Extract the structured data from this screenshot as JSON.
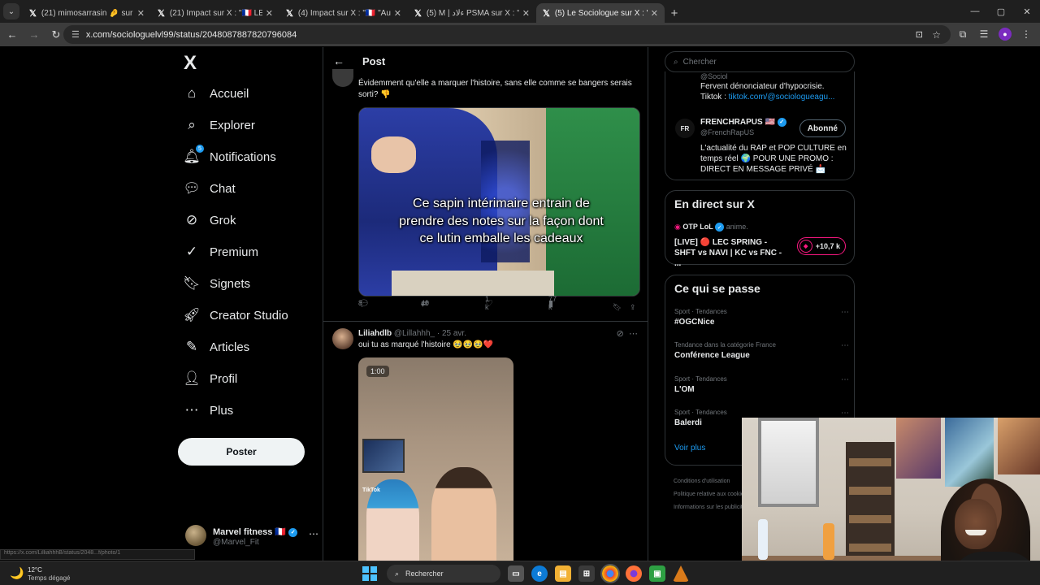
{
  "browser": {
    "tab_menu_icon": "chevron-down",
    "tabs": [
      {
        "title": "(21) mimosarrasin 🤌 sur X : \"C",
        "active": false
      },
      {
        "title": "(21) Impact sur X : \"🇫🇷 LE RAP",
        "active": false
      },
      {
        "title": "(4) Impact sur X : \"🇫🇷 \"Au bout d",
        "active": false
      },
      {
        "title": "(5) M | ءلاد PSMA sur X : \"Mais c",
        "active": false
      },
      {
        "title": "(5) Le Sociologue sur X : \"\"Vous",
        "active": true
      }
    ],
    "new_tab": "+",
    "window_controls": {
      "minimize": "—",
      "maximize": "▢",
      "close": "✕"
    },
    "url": "x.com/sociologuelvl99/status/2048087887820796084",
    "status_url": "https://x.com/LilliahhhB/status/2048...f/photo/1"
  },
  "sidebar": {
    "logo": "X",
    "items": [
      {
        "label": "Accueil",
        "icon": "⌂",
        "name": "home"
      },
      {
        "label": "Explorer",
        "icon": "⌕",
        "name": "explore"
      },
      {
        "label": "Notifications",
        "icon": "🔔︎",
        "name": "notifications",
        "badge": "5"
      },
      {
        "label": "Chat",
        "icon": "💬︎",
        "name": "chat"
      },
      {
        "label": "Grok",
        "icon": "⊘",
        "name": "grok"
      },
      {
        "label": "Premium",
        "icon": "✓",
        "name": "premium"
      },
      {
        "label": "Signets",
        "icon": "🔖︎",
        "name": "bookmarks"
      },
      {
        "label": "Creator Studio",
        "icon": "🚀︎",
        "name": "creator-studio"
      },
      {
        "label": "Articles",
        "icon": "✎",
        "name": "articles"
      },
      {
        "label": "Profil",
        "icon": "👤︎",
        "name": "profile"
      },
      {
        "label": "Plus",
        "icon": "⋯",
        "name": "more"
      }
    ],
    "post_button": "Poster",
    "account": {
      "name": "Marvel fitness 🇫🇷",
      "handle": "@Marvel_Fit",
      "more": "⋯"
    }
  },
  "main": {
    "header": {
      "back": "←",
      "title": "Post"
    },
    "reply1": {
      "text": "Évidemment qu'elle a marquer l'histoire, sans elle comme se bangers serais sorti? 👎",
      "media_caption": "Ce sapin intérimaire entrain de prendre des notes sur la façon dont ce lutin emballe les cadeaux",
      "replies": "8",
      "reposts": "40",
      "likes": "1 k",
      "views": "77 k"
    },
    "reply2": {
      "name": "Liliahdlb",
      "handle": "@Lillahhh_",
      "date": "· 25 avr.",
      "text": "oui tu as marqué l'histoire 🥹🥹🥹❤️",
      "media_time": "1:00",
      "media_watermark": "TikTok"
    }
  },
  "right": {
    "search_placeholder": "Chercher",
    "card1": {
      "top_handle": "@Sociol",
      "bio_line1": "Fervent dénonciateur d'hypocrisie.",
      "bio_tiktok_label": "Tiktok :",
      "bio_tiktok_link": "tiktok.com/@sociologueagu...",
      "account_name": "FRENCHRAPUS 🇺🇸",
      "account_handle": "@FrenchRapUS",
      "avatar_text": "FR",
      "follow_button": "Abonné",
      "account_bio": "L'actualité du RAP et POP CULTURE en temps réel 🌍 POUR UNE PROMO : DIRECT EN MESSAGE PRIVÉ 📩"
    },
    "live": {
      "title": "En direct sur X",
      "account": "OTP LoL",
      "account_suffix": "anime.",
      "text": "[LIVE] 🔴 LEC SPRING - SHFT vs NAVI | KC vs FNC - ...",
      "count": "+10,7 k"
    },
    "trends": {
      "title": "Ce qui se passe",
      "items": [
        {
          "context": "Sport · Tendances",
          "name": "#OGCNice"
        },
        {
          "context": "Tendance dans la catégorie France",
          "name": "Conférence League"
        },
        {
          "context": "Sport · Tendances",
          "name": "L'OM"
        },
        {
          "context": "Sport · Tendances",
          "name": "Balerdi"
        }
      ],
      "more": "Voir plus",
      "menu": "⋯"
    },
    "footer_links": [
      "Conditions d'utilisation",
      "Politique relative aux cookies",
      "Informations sur les publicités"
    ]
  },
  "taskbar": {
    "weather_temp": "12°C",
    "weather_desc": "Temps dégagé",
    "search_placeholder": "Rechercher"
  }
}
